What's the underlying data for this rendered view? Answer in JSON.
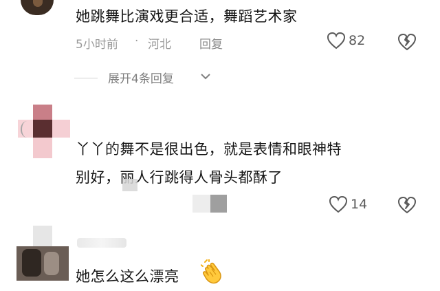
{
  "comments": [
    {
      "text": "她跳舞比演戏更合适，舞蹈艺术家",
      "time": "5小时前",
      "dot": "·",
      "location": "河北",
      "reply_label": "回复",
      "likes": "82",
      "like_icon": "heart-outline-icon",
      "dislike_icon": "broken-heart-icon"
    },
    {
      "text_line1": "丫丫的舞不是很出色，就是表情和眼神特",
      "text_line2": "别好，丽人行跳得人骨头都酥了",
      "likes": "14",
      "like_icon": "heart-outline-icon",
      "dislike_icon": "broken-heart-icon"
    },
    {
      "text": "她怎么这么漂亮",
      "emoji": "clapping-hands-icon"
    }
  ],
  "replies": {
    "expand_label": "展开4条回复"
  },
  "colors": {
    "text": "#151515",
    "meta": "#9a9a9a",
    "icon": "#5a5a5a",
    "clap": "#f5b21a"
  }
}
